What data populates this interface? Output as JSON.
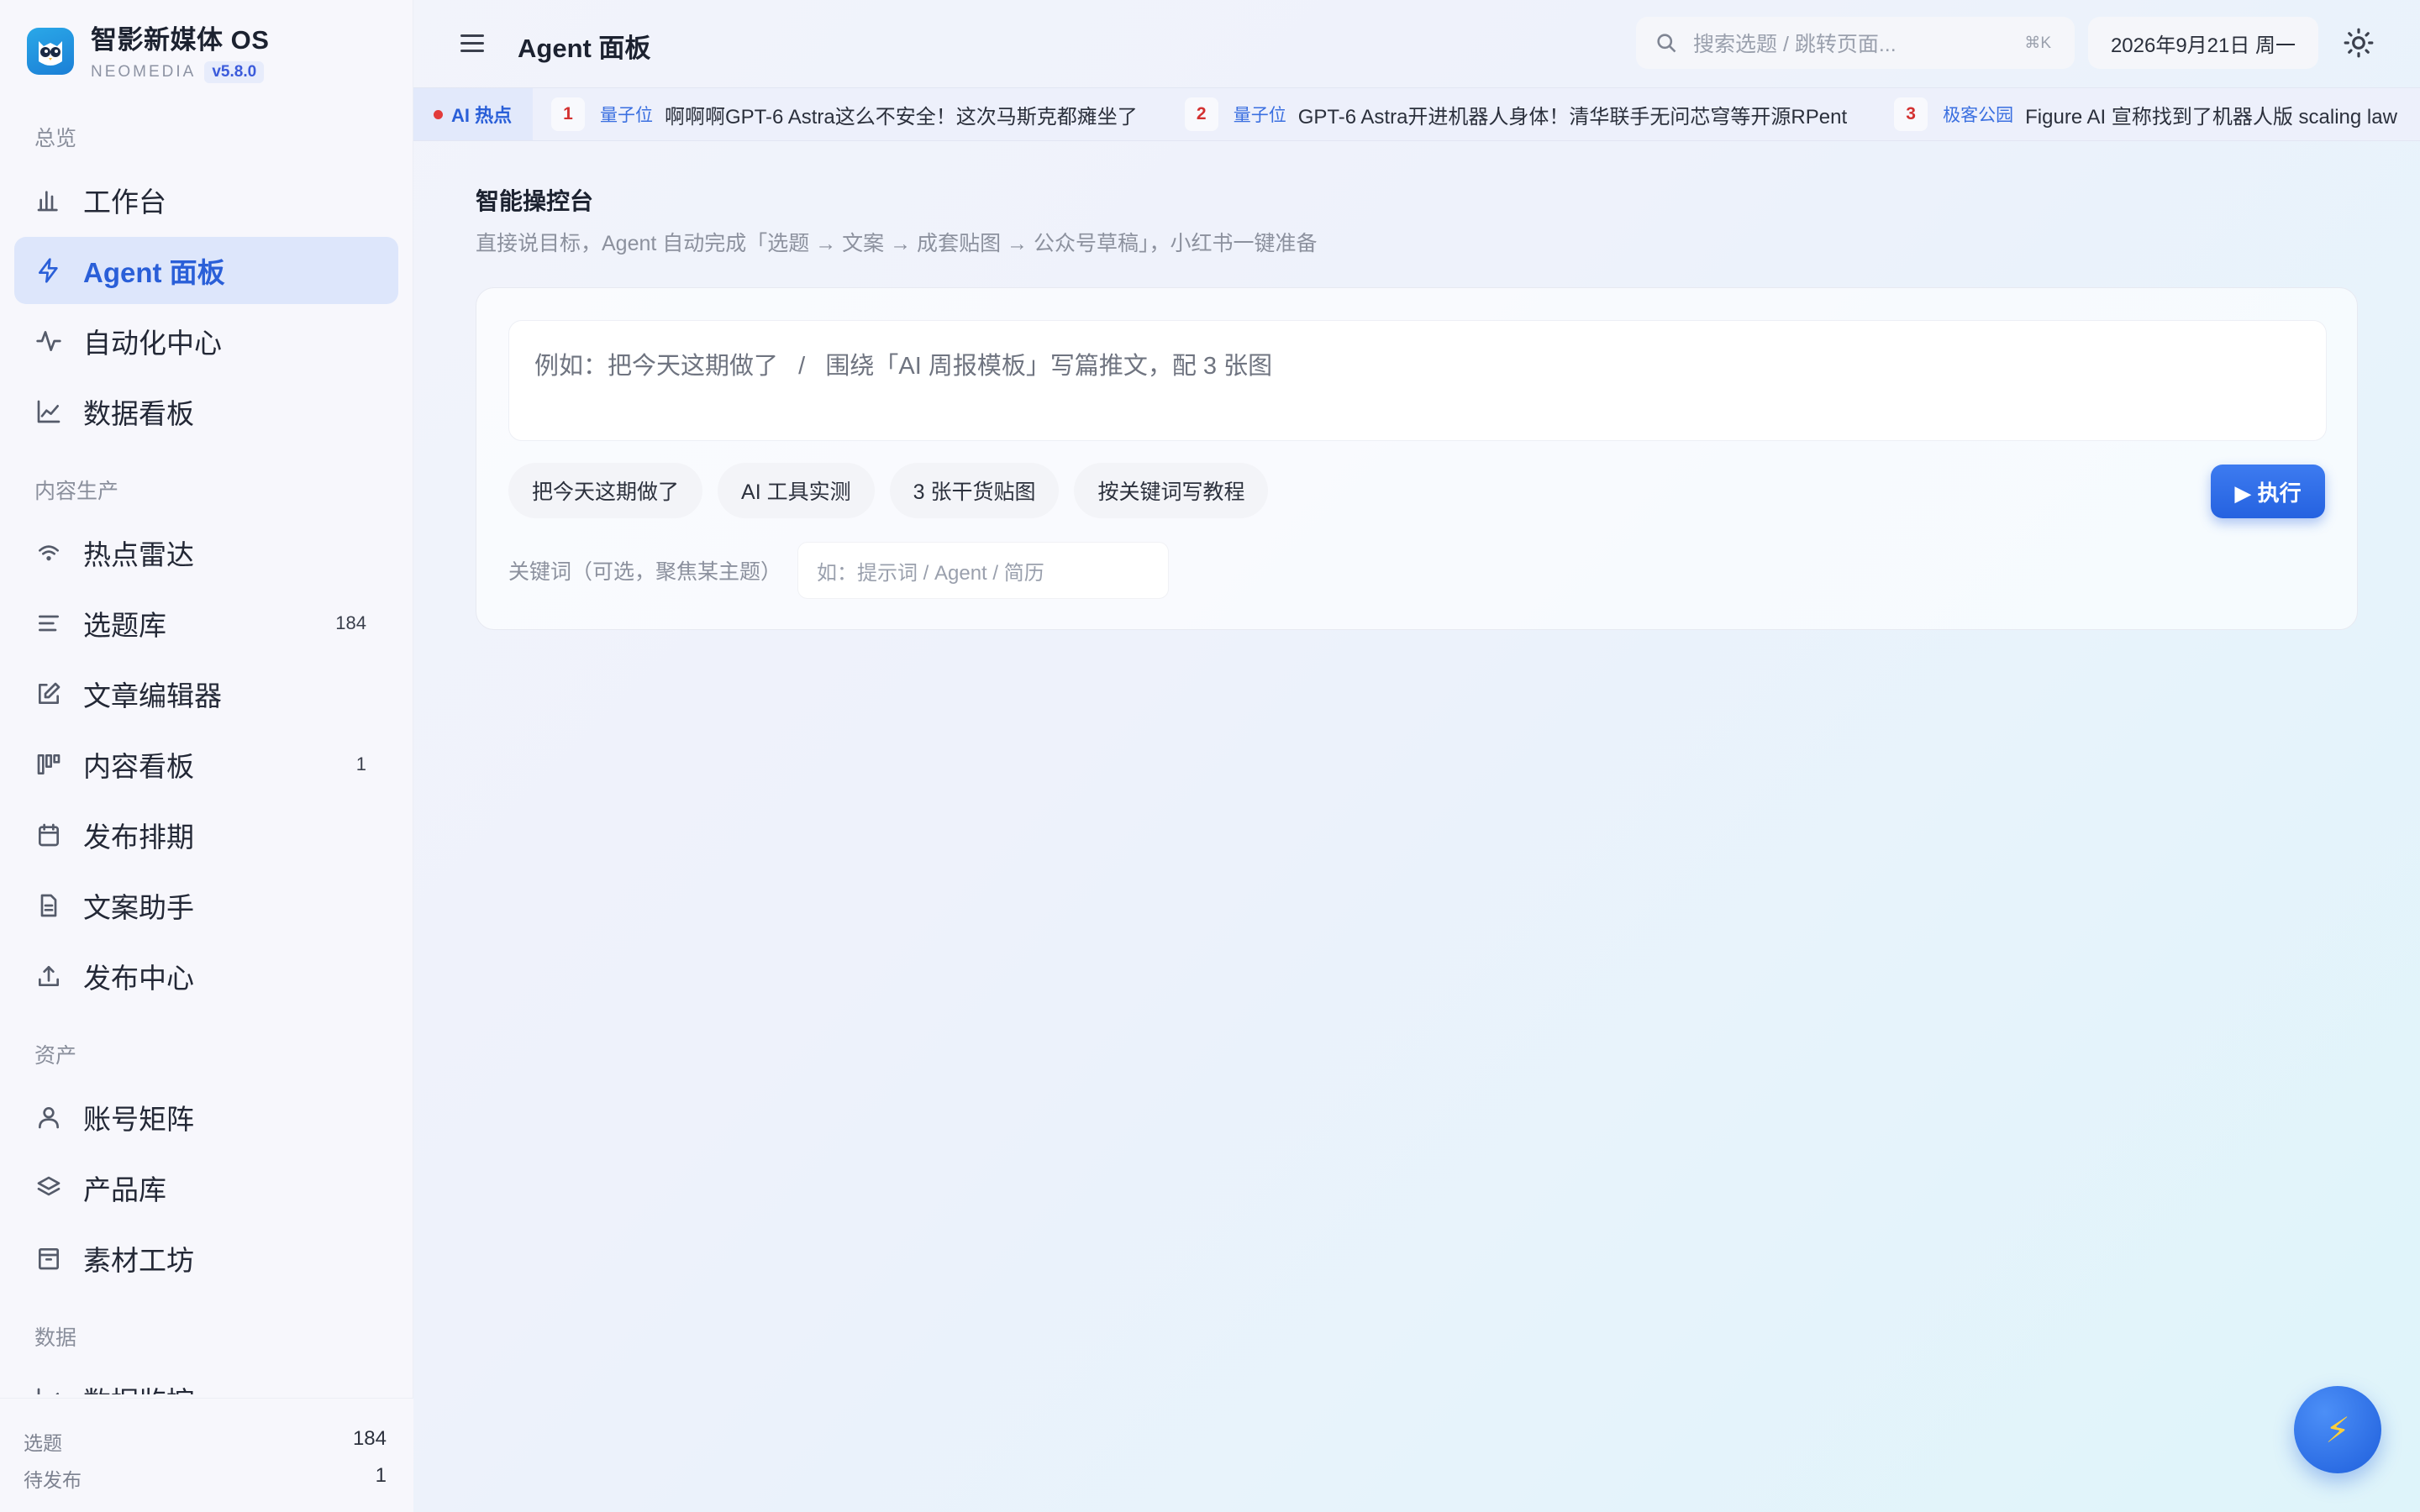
{
  "brand": {
    "title": "智影新媒体 OS",
    "subtitle": "NEOMEDIA",
    "version": "v5.8.0"
  },
  "sidebar": {
    "sections": [
      {
        "label": "总览",
        "items": [
          {
            "label": "工作台",
            "icon": "bar-chart-icon",
            "active": false
          },
          {
            "label": "Agent 面板",
            "icon": "lightning-icon",
            "active": true
          },
          {
            "label": "自动化中心",
            "icon": "activity-icon",
            "active": false
          },
          {
            "label": "数据看板",
            "icon": "line-chart-icon",
            "active": false
          }
        ]
      },
      {
        "label": "内容生产",
        "items": [
          {
            "label": "热点雷达",
            "icon": "wifi-icon",
            "active": false
          },
          {
            "label": "选题库",
            "icon": "list-icon",
            "count": "184",
            "active": false
          },
          {
            "label": "文章编辑器",
            "icon": "edit-icon",
            "active": false
          },
          {
            "label": "内容看板",
            "icon": "kanban-icon",
            "count": "1",
            "active": false
          },
          {
            "label": "发布排期",
            "icon": "calendar-icon",
            "active": false
          },
          {
            "label": "文案助手",
            "icon": "document-icon",
            "active": false
          },
          {
            "label": "发布中心",
            "icon": "upload-icon",
            "active": false
          }
        ]
      },
      {
        "label": "资产",
        "items": [
          {
            "label": "账号矩阵",
            "icon": "user-icon",
            "active": false
          },
          {
            "label": "产品库",
            "icon": "layers-icon",
            "active": false
          },
          {
            "label": "素材工坊",
            "icon": "archive-icon",
            "active": false
          }
        ]
      },
      {
        "label": "数据",
        "items": [
          {
            "label": "数据监控",
            "icon": "line-chart-icon",
            "active": false
          }
        ]
      }
    ],
    "footer": [
      {
        "label": "选题",
        "value": "184"
      },
      {
        "label": "待发布",
        "value": "1"
      }
    ]
  },
  "topbar": {
    "title": "Agent 面板",
    "search_placeholder": "搜索选题 / 跳转页面...",
    "search_shortcut": "⌘K",
    "date": "2026年9月21日 周一"
  },
  "ticker": {
    "label": "AI 热点",
    "items": [
      {
        "rank": "1",
        "source": "量子位",
        "title": "啊啊啊GPT-6 Astra这么不安全！这次马斯克都瘫坐了"
      },
      {
        "rank": "2",
        "source": "量子位",
        "title": "GPT-6 Astra开进机器人身体！清华联手无问芯穹等开源RPent"
      },
      {
        "rank": "3",
        "source": "极客公园",
        "title": "Figure AI 宣称找到了机器人版 scaling law"
      }
    ]
  },
  "main": {
    "title": "智能操控台",
    "subtitle": "直接说目标，Agent 自动完成「选题 → 文案 → 成套贴图 → 公众号草稿」，小红书一键准备",
    "prompt_placeholder": "例如：把今天这期做了   /   围绕「AI 周报模板」写篇推文，配 3 张图",
    "chips": [
      "把今天这期做了",
      "AI 工具实测",
      "3 张干货贴图",
      "按关键词写教程"
    ],
    "run_label": "▶ 执行",
    "keyword_label": "关键词（可选，聚焦某主题）",
    "keyword_placeholder": "如：提示词 / Agent / 简历"
  },
  "fab": {
    "icon": "lightning-icon",
    "glyph": "⚡"
  }
}
